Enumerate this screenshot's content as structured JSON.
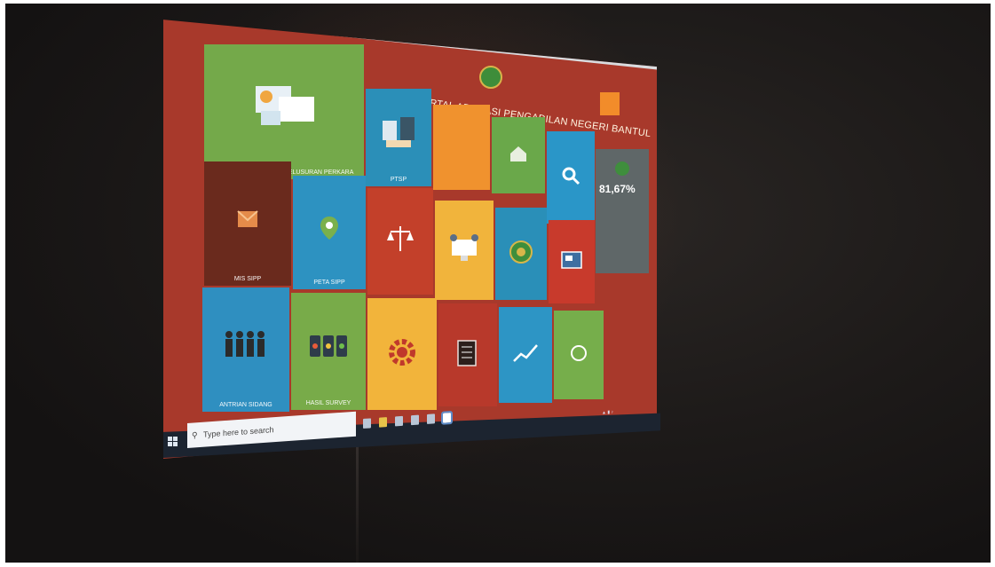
{
  "portal": {
    "title": "PORTAL APLIKASI PENGADILAN NEGERI BANTUL"
  },
  "tiles": [
    {
      "name": "sipp-tile",
      "label": "SISTEM INFORMASI PENELUSURAN PERKARA",
      "color": "#74a94a",
      "icon": "dashboard-screens-icon"
    },
    {
      "name": "ptsp-tile",
      "label": "PTSP",
      "color": "#2b8fb8",
      "icon": "building-handshake-icon"
    },
    {
      "name": "orange-tile",
      "label": "",
      "color": "#f0922e",
      "icon": "blank-icon"
    },
    {
      "name": "green-tile-2",
      "label": "",
      "color": "#6aa84a",
      "icon": "house-icon"
    },
    {
      "name": "blue-tile-2",
      "label": "",
      "color": "#2a96c8",
      "icon": "magnifier-icon"
    },
    {
      "name": "mis-sipp-tile",
      "label": "MIS SIPP",
      "color": "#6a2a1d",
      "icon": "envelope-icon"
    },
    {
      "name": "peta-sipp-tile",
      "label": "PETA SIPP",
      "color": "#2d92c1",
      "icon": "map-pin-icon"
    },
    {
      "name": "jdih-tile",
      "label": "",
      "color": "#c3402a",
      "icon": "scales-icon"
    },
    {
      "name": "yellow-tile",
      "label": "",
      "color": "#f1b43c",
      "icon": "computer-people-icon"
    },
    {
      "name": "seal-tile",
      "label": "",
      "color": "#2a8fb8",
      "icon": "seal-icon"
    },
    {
      "name": "red-tile-2",
      "label": "",
      "color": "#c83a2c",
      "icon": "id-card-icon"
    },
    {
      "name": "antrian-sidang-tile",
      "label": "ANTRIAN SIDANG",
      "color": "#2f8fc0",
      "icon": "people-queue-icon"
    },
    {
      "name": "hasil-survey-tile",
      "label": "HASIL SURVEY",
      "color": "#78ab49",
      "icon": "phones-icon"
    },
    {
      "name": "gear-tile",
      "label": "",
      "color": "#f2b43b",
      "icon": "gear-icon"
    },
    {
      "name": "checklist-tile",
      "label": "",
      "color": "#b8392b",
      "icon": "checklist-icon"
    },
    {
      "name": "chart-tile",
      "label": "",
      "color": "#2d95c5",
      "icon": "chart-icon"
    },
    {
      "name": "green-tile-3",
      "label": "",
      "color": "#76ae4b",
      "icon": "circle-icon"
    }
  ],
  "side_panel": {
    "percent": "81,67%"
  },
  "taskbar": {
    "search_placeholder": "Type here to search"
  }
}
